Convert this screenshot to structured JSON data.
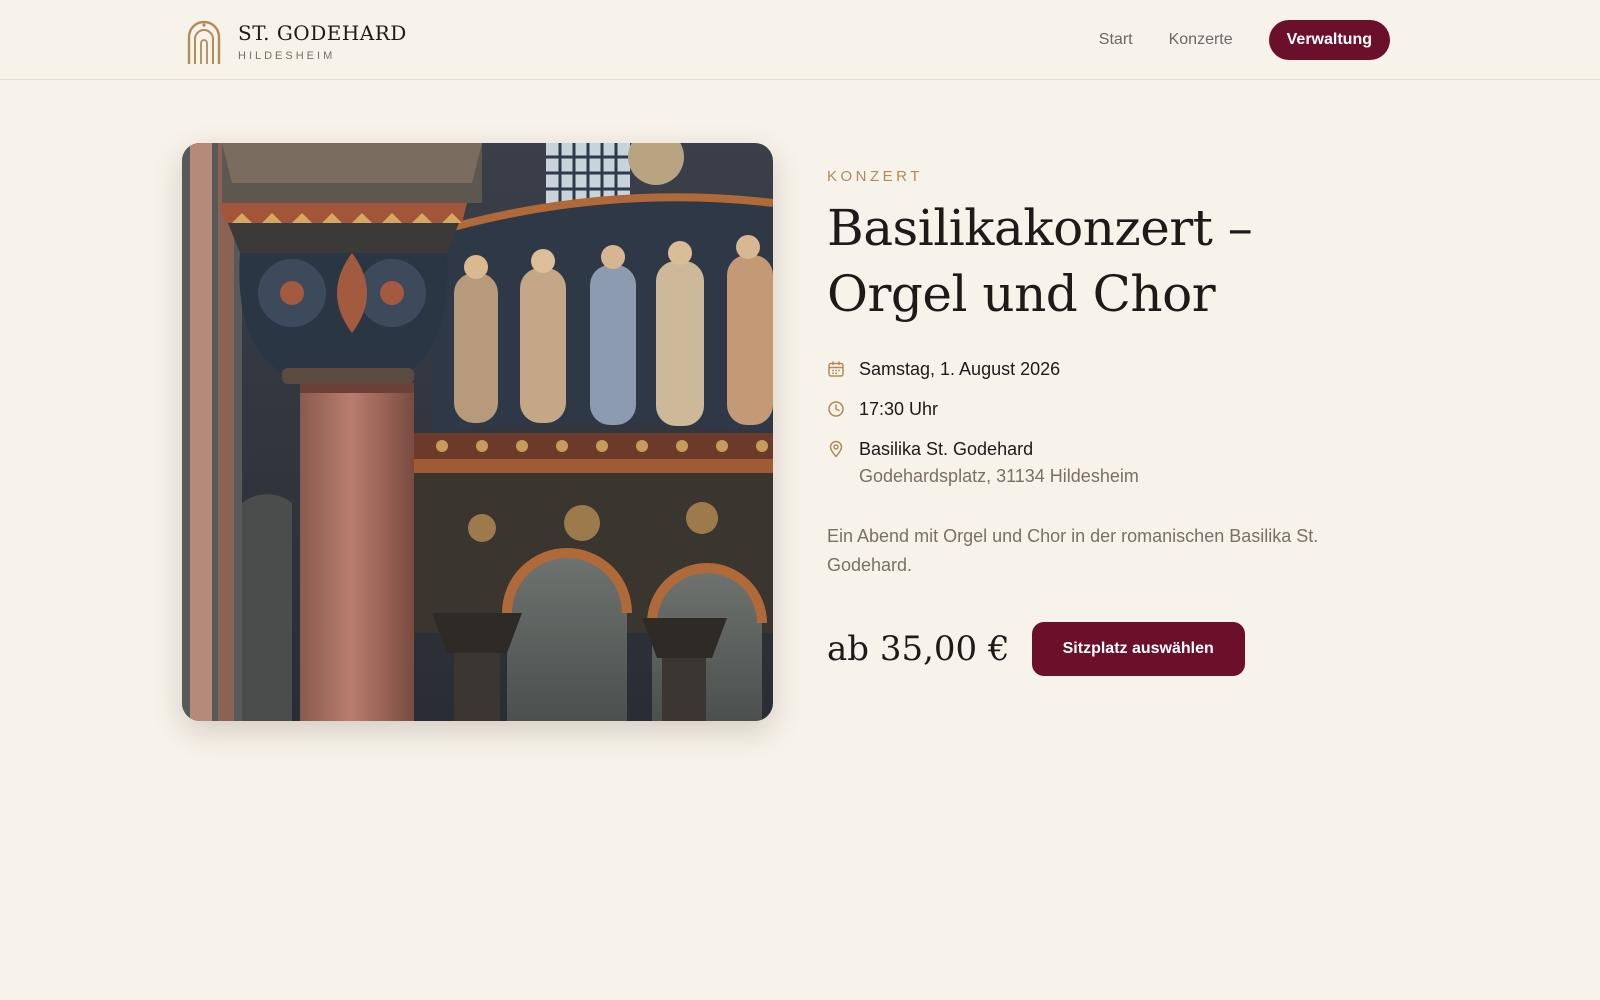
{
  "brand": {
    "name": "ST. GODEHARD",
    "city": "HILDESHEIM",
    "logo_icon": "arch-logo-icon"
  },
  "nav": {
    "links": [
      "Start",
      "Konzerte"
    ],
    "admin_button": "Verwaltung"
  },
  "event": {
    "category": "KONZERT",
    "title": "Basilikakonzert – Orgel und Chor",
    "date": "Samstag, 1. August 2026",
    "time": "17:30 Uhr",
    "venue": "Basilika St. Godehard",
    "address": "Godehardsplatz, 31134 Hildesheim",
    "description": "Ein Abend mit Orgel und Chor in der romanischen Basilika St. Godehard.",
    "price": "ab 35,00 €",
    "cta_label": "Sitzplatz auswählen",
    "icons": [
      "calendar-icon",
      "clock-icon",
      "map-pin-icon"
    ]
  },
  "colors": {
    "background": "#f7f2ea",
    "accent": "#6b0f2b",
    "gold": "#b08d57",
    "text": "#1f1a17",
    "muted": "#7a7068"
  }
}
